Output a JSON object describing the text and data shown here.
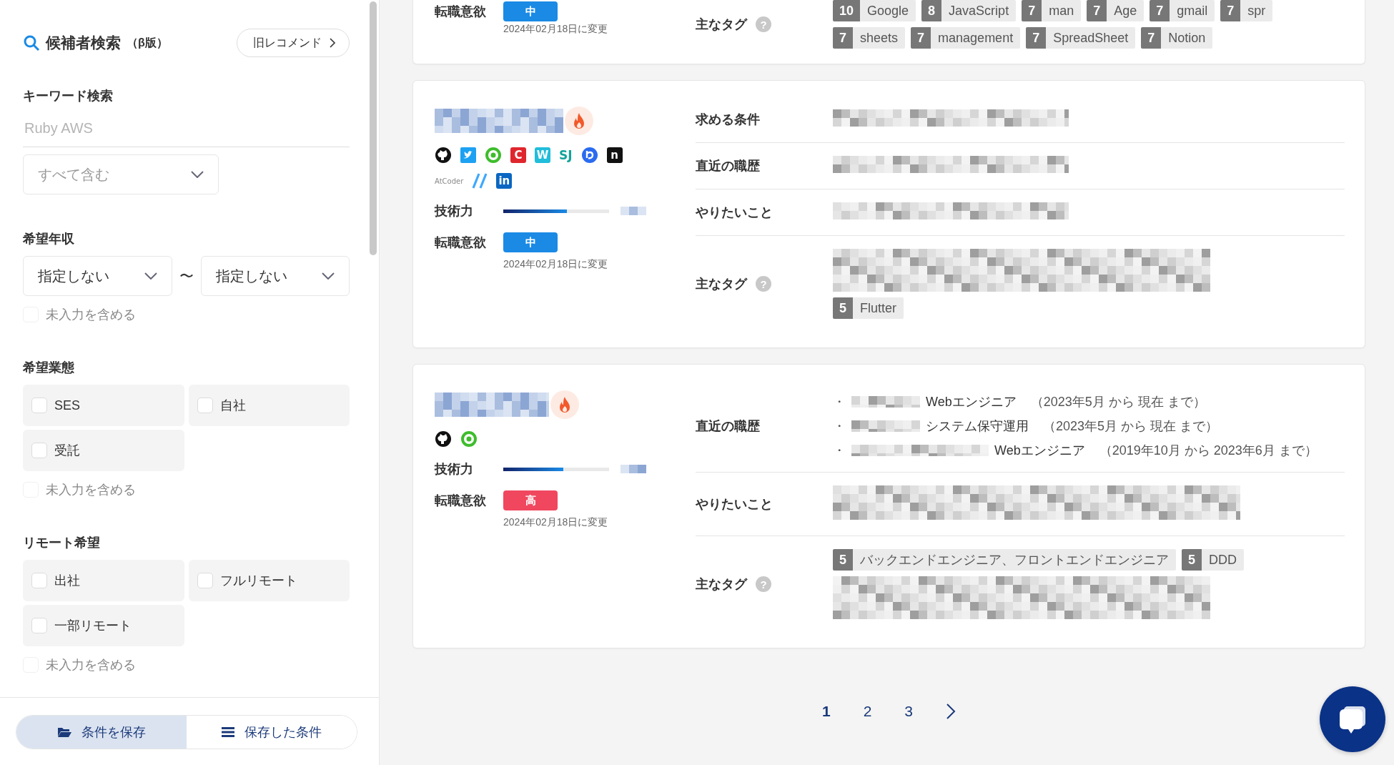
{
  "sidebar": {
    "title": "候補者検索",
    "title_note": "（β版）",
    "legacy_button": "旧レコメンド",
    "keyword": {
      "label": "キーワード検索",
      "placeholder": "Ruby AWS",
      "match": "すべて含む"
    },
    "salary": {
      "label": "希望年収",
      "min": "指定しない",
      "separator": "〜",
      "max": "指定しない",
      "include_empty": {
        "label": "未入力を含める",
        "checked": false
      }
    },
    "filters": [
      {
        "label": "希望業態",
        "options": [
          {
            "label": "SES",
            "checked": false
          },
          {
            "label": "自社",
            "checked": false
          },
          {
            "label": "受託",
            "checked": false
          }
        ],
        "include_empty": {
          "label": "未入力を含める",
          "checked": false
        }
      },
      {
        "label": "リモート希望",
        "options": [
          {
            "label": "出社",
            "checked": false
          },
          {
            "label": "フルリモート",
            "checked": false
          },
          {
            "label": "一部リモート",
            "checked": false
          }
        ],
        "include_empty": {
          "label": "未入力を含める",
          "checked": false
        }
      }
    ],
    "actions": [
      {
        "label": "条件を保存",
        "selected": true
      },
      {
        "label": "保存した条件",
        "selected": false
      }
    ]
  },
  "candidates": [
    {
      "intent": {
        "label": "転職意欲",
        "value": "中",
        "color": "#1a8ae5"
      },
      "changed": "2024年02月18日に変更",
      "rows": [
        {
          "label": "主なタグ",
          "help": "?",
          "kind": "tags",
          "lines": [
            {
              "kind": "tags",
              "tags": [
                {
                  "count": "10",
                  "label": "Google"
                },
                {
                  "count": "8",
                  "label": "JavaScript"
                },
                {
                  "count": "7",
                  "label": "man"
                },
                {
                  "count": "7",
                  "label": "Age"
                },
                {
                  "count": "7",
                  "label": "gmail"
                },
                {
                  "count": "7",
                  "label": "spr"
                }
              ]
            },
            {
              "kind": "tags",
              "tags": [
                {
                  "count": "7",
                  "label": "sheets"
                },
                {
                  "count": "7",
                  "label": "management"
                },
                {
                  "count": "7",
                  "label": "SpreadSheet"
                },
                {
                  "count": "7",
                  "label": "Notion"
                }
              ]
            }
          ]
        }
      ]
    },
    {
      "hot": true,
      "links": [
        {
          "kind": "github"
        },
        {
          "kind": "bird",
          "color": "#1da1f2"
        },
        {
          "kind": "ring",
          "color": "#3ebd2c"
        },
        {
          "kind": "tile",
          "glyph": "C",
          "color": "#e0262d"
        },
        {
          "kind": "tile",
          "glyph": "W",
          "color": "#21bddb"
        },
        {
          "kind": "text",
          "glyph": "SJ",
          "color": "#11a39b"
        },
        {
          "kind": "disc",
          "color": "#2a6bf0"
        },
        {
          "kind": "tile",
          "glyph": "n",
          "color": "#111111"
        },
        {
          "kind": "text",
          "glyph": "AtCoder",
          "color": "#8a8a8a"
        },
        {
          "kind": "slash",
          "color": "#3ea8ff"
        },
        {
          "kind": "tile",
          "glyph": "in",
          "color": "#0a66c2"
        }
      ],
      "skill": {
        "label": "技術力",
        "level": 0.6
      },
      "intent": {
        "label": "転職意欲",
        "value": "中",
        "color": "#1a8ae5"
      },
      "changed": "2024年02月18日に変更",
      "rows": [
        {
          "label": "求める条件",
          "kind": "redacted"
        },
        {
          "label": "直近の職歴",
          "kind": "redacted"
        },
        {
          "label": "やりたいこと",
          "kind": "redacted"
        },
        {
          "label": "主なタグ",
          "help": "?",
          "kind": "tags",
          "lines": [
            {
              "kind": "redacted"
            },
            {
              "kind": "tags",
              "tags": [
                {
                  "count": "5",
                  "label": "Flutter"
                }
              ]
            }
          ]
        }
      ]
    },
    {
      "hot": true,
      "links": [
        {
          "kind": "github"
        },
        {
          "kind": "ring",
          "color": "#3ebd2c"
        }
      ],
      "skill": {
        "label": "技術力",
        "level": 0.57
      },
      "intent": {
        "label": "転職意欲",
        "value": "高",
        "color": "#f0475f"
      },
      "changed": "2024年02月18日に変更",
      "rows": [
        {
          "label": "直近の職歴",
          "kind": "history",
          "items": [
            {
              "bullet": "・",
              "title": "Webエンジニア",
              "period": "（2023年5月 から 現在 まで）"
            },
            {
              "bullet": "・",
              "title": "システム保守運用",
              "period": "（2023年5月 から 現在 まで）"
            },
            {
              "bullet": "・",
              "title": "Webエンジニア",
              "period": "（2019年10月 から 2023年6月 まで）"
            }
          ]
        },
        {
          "label": "やりたいこと",
          "kind": "redacted_long"
        },
        {
          "label": "主なタグ",
          "help": "?",
          "kind": "tags",
          "lines": [
            {
              "kind": "tags",
              "tags": [
                {
                  "count": "5",
                  "label": "バックエンドエンジニア、フロントエンドエンジニア"
                },
                {
                  "count": "5",
                  "label": "DDD"
                }
              ]
            },
            {
              "kind": "redacted"
            }
          ]
        }
      ]
    }
  ],
  "pagination": {
    "pages": [
      {
        "label": "1",
        "selected": true
      },
      {
        "label": "2",
        "selected": false
      },
      {
        "label": "3",
        "selected": false
      }
    ]
  }
}
